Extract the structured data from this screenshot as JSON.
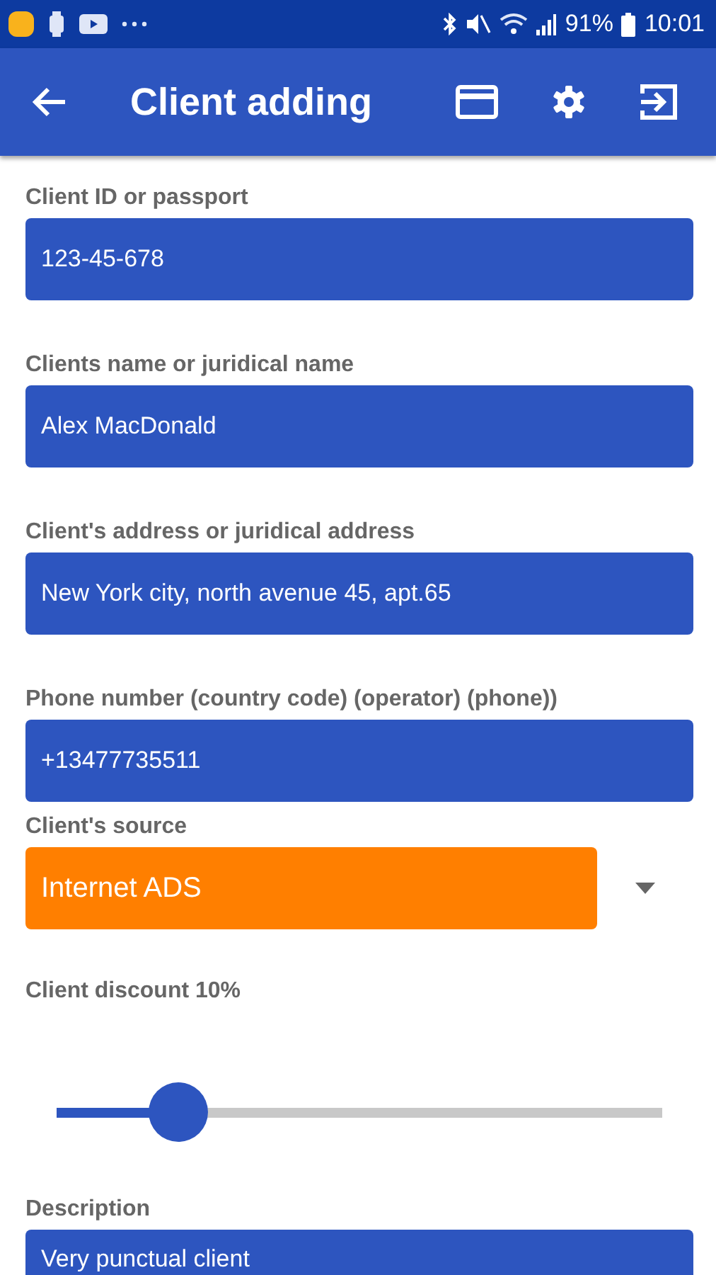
{
  "status_bar": {
    "battery": "91%",
    "time": "10:01"
  },
  "app_bar": {
    "title": "Client adding"
  },
  "form": [
    {
      "kind": "text",
      "label": "Client ID or passport",
      "value": "123-45-678"
    },
    {
      "kind": "text",
      "label": "Clients name or juridical name",
      "value": "Alex MacDonald"
    },
    {
      "kind": "text",
      "label": "Client's address or juridical address",
      "value": "New York city, north avenue 45, apt.65"
    },
    {
      "kind": "text",
      "label": "Phone number (country code) (operator) (phone))",
      "value": "+13477735511"
    },
    {
      "kind": "dropdown",
      "label": "Client's source",
      "value": "Internet ADS"
    },
    {
      "kind": "slider",
      "label": "Client discount 10%",
      "level": 0.2
    },
    {
      "kind": "text",
      "label": "Description",
      "value": "Very punctual client"
    }
  ]
}
